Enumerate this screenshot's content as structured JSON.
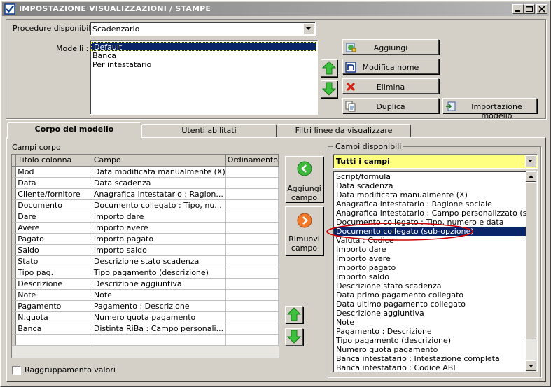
{
  "window": {
    "title": "IMPOSTAZIONE VISUALIZZAZIONI / STAMPE"
  },
  "procedure": {
    "label": "Procedure disponibili :",
    "value": "Scadenzario"
  },
  "modelli": {
    "label": "Modelli :",
    "items": [
      "Default",
      "Banca",
      "Per intestatario"
    ],
    "selected": 0
  },
  "buttons": {
    "aggiungi": "Aggiungi",
    "modifica_nome": "Modifica nome",
    "elimina": "Elimina",
    "duplica": "Duplica",
    "importazione_modello": "Importazione modello",
    "aggiungi_campo": [
      "Aggiungi",
      "campo"
    ],
    "rimuovi_campo": [
      "Rimuovi",
      "campo"
    ]
  },
  "tabs": [
    "Corpo del modello",
    "Utenti abilitati",
    "Filtri linee da visualizzare"
  ],
  "campi_corpo": {
    "label": "Campi corpo",
    "columns": [
      "Titolo colonna",
      "Campo",
      "Ordinamento"
    ],
    "rows": [
      [
        "Mod",
        "Data modificata manualmente (X)",
        ""
      ],
      [
        "Data",
        "Data scadenza",
        ""
      ],
      [
        "Cliente/fornitore",
        "Anagrafica intestatario : Ragion...",
        ""
      ],
      [
        "Documento",
        "Documento collegato : Tipo, nu...",
        ""
      ],
      [
        "Dare",
        "Importo dare",
        ""
      ],
      [
        "Avere",
        "Importo avere",
        ""
      ],
      [
        "Pagato",
        "Importo pagato",
        ""
      ],
      [
        "Saldo",
        "Importo saldo",
        ""
      ],
      [
        "Stato",
        "Descrizione stato scadenza",
        ""
      ],
      [
        "Tipo pag.",
        "Tipo pagamento (descrizione)",
        ""
      ],
      [
        "Descrizione",
        "Descrizione aggiuntiva",
        ""
      ],
      [
        "Note",
        "Note",
        ""
      ],
      [
        "Pagamento",
        "Pagamento : Descrizione",
        ""
      ],
      [
        "N.quota",
        "Numero quota pagamento",
        ""
      ],
      [
        "Banca",
        "Distinta RiBa : Campo personali...",
        ""
      ]
    ]
  },
  "raggruppamento": {
    "label": "Raggruppamento valori",
    "checked": false
  },
  "campi_disponibili": {
    "label": "Campi disponibili",
    "filter": "Tutti i campi",
    "items": [
      "Script/formula",
      "Data scadenza",
      "Data modificata manualmente (X)",
      "Anagrafica intestatario : Ragione sociale",
      "Anagrafica intestatario : Campo personalizzato (sub-opzion",
      "Documento collegato : Tipo, numero e data",
      "Documento collegato (sub-opzione)",
      "Valuta : Codice",
      "Importo dare",
      "Importo avere",
      "Importo pagato",
      "Importo saldo",
      "Descrizione stato scadenza",
      "Data primo pagamento collegato",
      "Data ultimo pagamento collegato",
      "Descrizione aggiuntiva",
      "Note",
      "Pagamento : Descrizione",
      "Tipo pagamento (descrizione)",
      "Numero quota pagamento",
      "Banca intestatario : Intestazione completa",
      "Banca intestatario : Codice ABI"
    ],
    "selected": 6
  },
  "colors": {
    "highlight_yellow": "#ffff80",
    "selection": "#0a246a",
    "annotation_red": "#cc0000"
  }
}
